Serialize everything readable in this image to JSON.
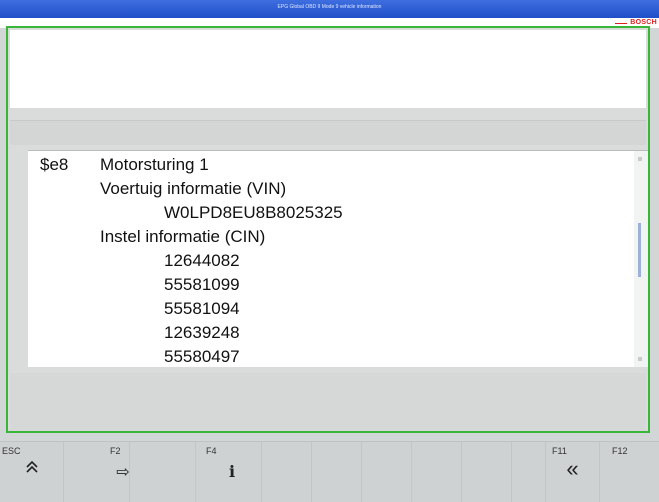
{
  "window": {
    "title": "EPG  Global OBD II  Mode 9  vehicle information"
  },
  "brand": {
    "name": "BOSCH",
    "color": "#e02020"
  },
  "accent": {
    "border": "#39b539",
    "titlebar": "#2a58d0"
  },
  "vehicle_info": {
    "ecu_id": "$e8",
    "ecu_name": "Motorsturing 1",
    "vin_label": "Voertuig informatie (VIN)",
    "vin_value": "W0LPD8EU8B8025325",
    "cin_label": "Instel informatie (CIN)",
    "cin_values": [
      "12644082",
      "55581099",
      "55581094",
      "12639248",
      "55580497"
    ]
  },
  "function_keys": [
    {
      "key": "ESC",
      "icon": "double-chevron-up-icon",
      "glyph": "⌃"
    },
    {
      "key": "F2",
      "icon": "arrow-right-icon",
      "glyph": "⇨"
    },
    {
      "key": "F4",
      "icon": "info-icon",
      "glyph": "i"
    },
    {
      "key": "F11",
      "icon": "double-chevron-left-icon",
      "glyph": "«"
    },
    {
      "key": "F12",
      "icon": "",
      "glyph": ""
    }
  ]
}
